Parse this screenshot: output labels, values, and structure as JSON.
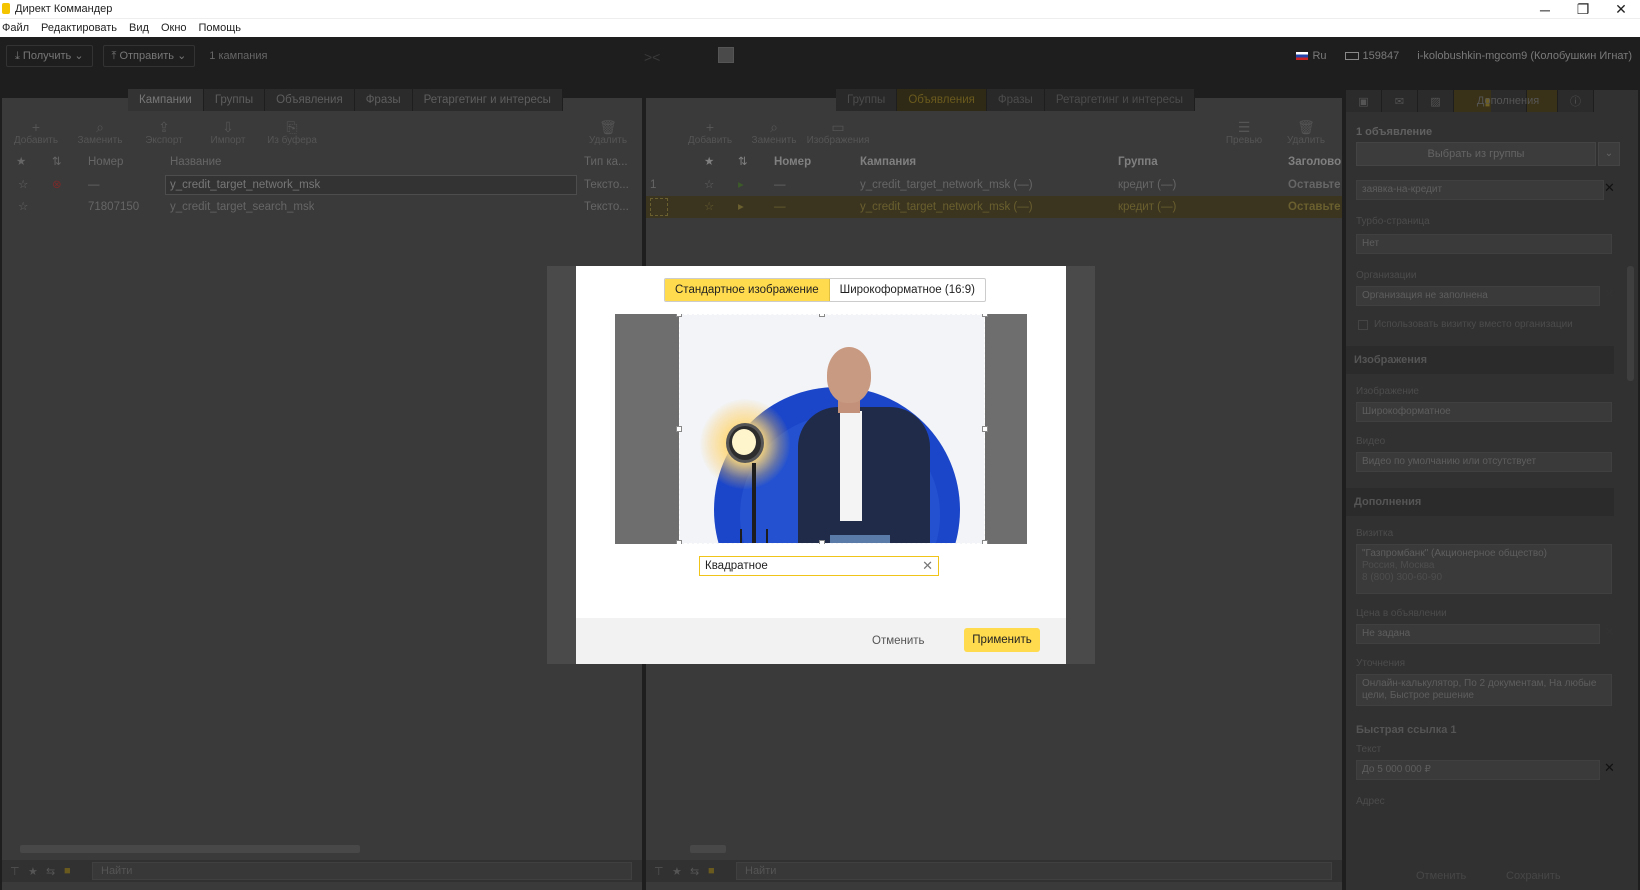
{
  "window": {
    "title": "Директ Коммандер",
    "minimize_glyph": "─",
    "restore_glyph": "❐",
    "close_glyph": "✕"
  },
  "menu": [
    "Файл",
    "Редактировать",
    "Вид",
    "Окно",
    "Помощь"
  ],
  "topbar": {
    "get_label": "⤓ Получить ⌄",
    "send_label": "⤒ Отправить ⌄",
    "campaigns_count": "1 кампания",
    "lang": "Ru",
    "balance": "159847",
    "account": "i-kolobushkin-mgcom9 (Колобушкин Игнат)"
  },
  "left": {
    "tabs": [
      "Кампании",
      "Группы",
      "Объявления",
      "Фразы",
      "Ретаргетинг и интересы"
    ],
    "toolbar": [
      {
        "icon": "+",
        "label": "Добавить"
      },
      {
        "icon": "⌕",
        "label": "Заменить"
      },
      {
        "icon": "⇪",
        "label": "Экспорт"
      },
      {
        "icon": "⇩",
        "label": "Импорт"
      },
      {
        "icon": "⎘",
        "label": "Из буфера"
      }
    ],
    "delete_label": "Удалить",
    "columns": {
      "number": "Номер",
      "name": "Название",
      "type": "Тип ка..."
    },
    "rows": [
      {
        "number": "—",
        "name": "y_credit_target_network_msk",
        "type": "Тексто..."
      },
      {
        "number": "71807150",
        "name": "y_credit_target_search_msk",
        "type": "Тексто..."
      }
    ],
    "search_placeholder": "Найти"
  },
  "right": {
    "tabs": [
      "Группы",
      "Объявления",
      "Фразы",
      "Ретаргетинг и интересы"
    ],
    "toolbar": [
      {
        "icon": "+",
        "label": "Добавить"
      },
      {
        "icon": "⌕",
        "label": "Заменить"
      },
      {
        "icon": "▭",
        "label": "Изображения"
      }
    ],
    "preview_label": "Превью",
    "delete_label": "Удалить",
    "columns": {
      "number": "Номер",
      "campaign": "Кампания",
      "group": "Группа",
      "title": "Заголово"
    },
    "rows": [
      {
        "idx": "1",
        "number": "—",
        "campaign": "y_credit_target_network_msk (—)",
        "group": "кредит (—)",
        "title": "Оставьте"
      },
      {
        "idx": "",
        "number": "—",
        "campaign": "y_credit_target_network_msk (—)",
        "group": "кредит (—)",
        "title": "Оставьте"
      }
    ],
    "search_placeholder": "Найти"
  },
  "sidebar": {
    "active_tab": "Дополнения",
    "ad_count": "1 объявление",
    "choose_group": "Выбрать из группы",
    "name_value": "заявка-на-кредит",
    "turbo_label": "Турбо-страница",
    "turbo_value": "Нет",
    "org_label": "Организации",
    "org_value": "Организация не заполнена",
    "use_card_label": "Использовать визитку вместо организации",
    "images_section": "Изображения",
    "image_label": "Изображение",
    "image_value": "Широкоформатное",
    "video_label": "Видео",
    "video_value": "Видео по умолчанию или отсутствует",
    "extras_section": "Дополнения",
    "card_label": "Визитка",
    "card_line1": "\"Газпромбанк\" (Акционерное общество)",
    "card_line2": "Россия, Москва",
    "card_line3": "8 (800) 300-60-90",
    "price_label": "Цена в объявлении",
    "price_value": "Не задана",
    "clarify_label": "Уточнения",
    "clarify_value": "Онлайн-калькулятор, По 2 документам, На любые цели, Быстрое решение",
    "quicklink_title": "Быстрая ссылка 1",
    "text_label": "Текст",
    "text_value": "До 5 000 000 ₽",
    "address_label": "Адрес",
    "cancel_label": "Отменить",
    "save_label": "Сохранить"
  },
  "modal": {
    "tab_standard": "Стандартное изображение",
    "tab_wide": "Широкоформатное (16:9)",
    "preset_value": "Квадратное",
    "cancel_label": "Отменить",
    "apply_label": "Применить"
  },
  "colors": {
    "accent_yellow": "#ffdb4d",
    "dark_bg": "#1e1e1e",
    "panel_bg": "#3a3a3a",
    "photo_blue": "#1c46c9"
  }
}
